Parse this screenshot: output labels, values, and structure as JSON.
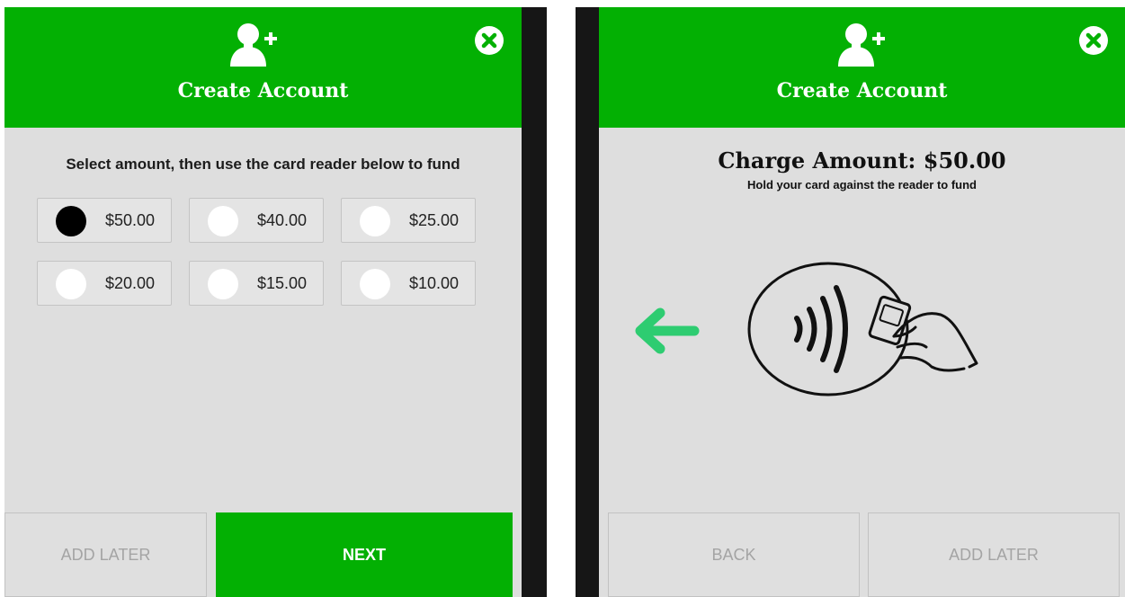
{
  "left_screen": {
    "header": {
      "title": "Create Account",
      "icon": "add-user-icon",
      "close_icon": "close-icon"
    },
    "instruction": "Select amount, then use the card reader below to fund",
    "amounts": [
      {
        "label": "$50.00",
        "selected": true
      },
      {
        "label": "$40.00",
        "selected": false
      },
      {
        "label": "$25.00",
        "selected": false
      },
      {
        "label": "$20.00",
        "selected": false
      },
      {
        "label": "$15.00",
        "selected": false
      },
      {
        "label": "$10.00",
        "selected": false
      }
    ],
    "buttons": {
      "add_later": "ADD LATER",
      "next": "NEXT"
    }
  },
  "right_screen": {
    "header": {
      "title": "Create Account",
      "icon": "add-user-icon",
      "close_icon": "close-icon"
    },
    "charge_title": "Charge Amount: $50.00",
    "charge_subtitle": "Hold your card against the reader to fund",
    "illustration": "contactless-card-reader-icon",
    "arrow_icon": "arrow-left-icon",
    "buttons": {
      "back": "BACK",
      "add_later": "ADD LATER"
    }
  },
  "colors": {
    "brand_green": "#03b003",
    "arrow_green": "#2ecc71",
    "panel_background": "#dedede",
    "divider": "#161616"
  }
}
